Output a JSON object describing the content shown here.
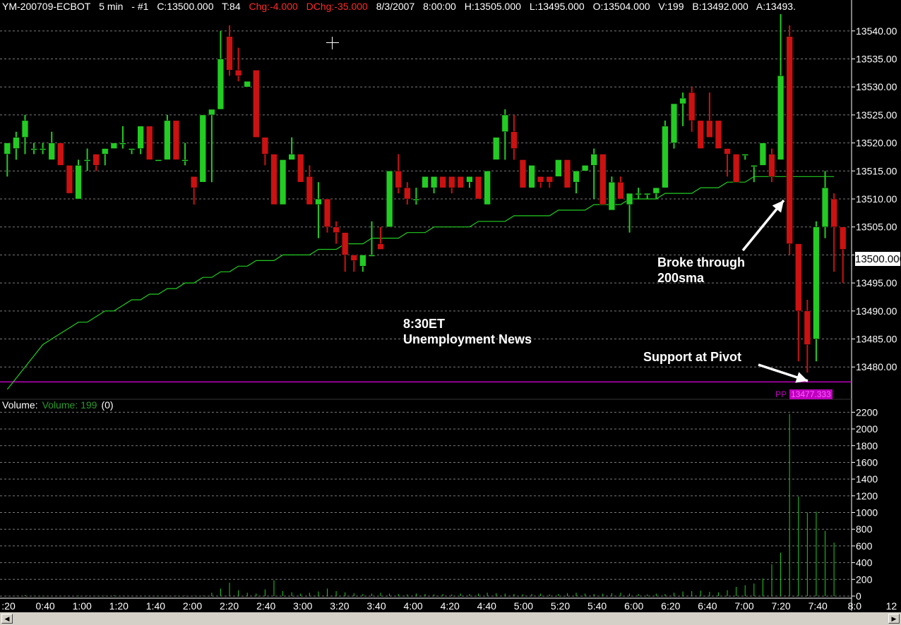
{
  "header": {
    "symbol": "YM-200709-ECBOT",
    "interval": "5 min",
    "chart_id": "- #1",
    "close": "C:13500.000",
    "ticks": "T:84",
    "change": "Chg:-4.000",
    "day_change": "DChg:-35.000",
    "date": "8/3/2007",
    "time": "8:00:00",
    "high": "H:13505.000",
    "low": "L:13495.000",
    "open": "O:13504.000",
    "volume": "V:199",
    "bid": "B:13492.000",
    "ask": "A:13493."
  },
  "volume_legend": {
    "label": "Volume:",
    "series": "Volume: 199",
    "value": "(0)"
  },
  "annotations": {
    "news_line1": "8:30ET",
    "news_line2": "Unemployment News",
    "sma_line1": "Broke through",
    "sma_line2": "200sma",
    "pivot": "Support at Pivot"
  },
  "pivot": {
    "label": "PP",
    "value": "13477.333",
    "color": "#c000c0"
  },
  "current_price_label": "13500.000",
  "colors": {
    "up": "#22cc22",
    "down": "#cc1111",
    "sma": "#22cc22",
    "grid": "#7a7a7a",
    "background": "#000000"
  },
  "chart_data": {
    "type": "candlestick",
    "price_ticks": [
      "13540.00",
      "13535.00",
      "13530.00",
      "13525.00",
      "13520.00",
      "13515.00",
      "13510.00",
      "13505.00",
      "13500.00",
      "13495.00",
      "13490.00",
      "13485.00",
      "13480.00"
    ],
    "price_range": [
      13476,
      13543
    ],
    "volume_ticks": [
      "2200",
      "2000",
      "1800",
      "1600",
      "1400",
      "1200",
      "1000",
      "800",
      "600",
      "400",
      "200",
      "0"
    ],
    "volume_range": [
      0,
      2220
    ],
    "time_ticks": [
      ":20",
      "0:40",
      "1:00",
      "1:20",
      "1:40",
      "2:00",
      "2:20",
      "2:40",
      "3:00",
      "3:20",
      "3:40",
      "4:00",
      "4:20",
      "4:40",
      "5:00",
      "5:20",
      "5:40",
      "6:00",
      "6:20",
      "6:40",
      "7:00",
      "7:20",
      "7:40",
      "8:0",
      "12"
    ],
    "candles": [
      {
        "o": 13518,
        "h": 13520,
        "l": 13514,
        "c": 13520
      },
      {
        "o": 13519,
        "h": 13522,
        "l": 13517,
        "c": 13521
      },
      {
        "o": 13521,
        "h": 13525,
        "l": 13518,
        "c": 13524
      },
      {
        "o": 13519,
        "h": 13520,
        "l": 13518,
        "c": 13519
      },
      {
        "o": 13519,
        "h": 13520,
        "l": 13518,
        "c": 13519
      },
      {
        "o": 13517,
        "h": 13522,
        "l": 13517,
        "c": 13520
      },
      {
        "o": 13520,
        "h": 13520,
        "l": 13516,
        "c": 13516
      },
      {
        "o": 13516,
        "h": 13516,
        "l": 13511,
        "c": 13511
      },
      {
        "o": 13510,
        "h": 13517,
        "l": 13510,
        "c": 13516
      },
      {
        "o": 13517,
        "h": 13519,
        "l": 13515,
        "c": 13517
      },
      {
        "o": 13518,
        "h": 13518,
        "l": 13515,
        "c": 13516
      },
      {
        "o": 13518,
        "h": 13519,
        "l": 13516,
        "c": 13519
      },
      {
        "o": 13519,
        "h": 13520,
        "l": 13519,
        "c": 13520
      },
      {
        "o": 13520,
        "h": 13523,
        "l": 13519,
        "c": 13520
      },
      {
        "o": 13519,
        "h": 13519,
        "l": 13518,
        "c": 13519
      },
      {
        "o": 13519,
        "h": 13523,
        "l": 13518,
        "c": 13523
      },
      {
        "o": 13523,
        "h": 13523,
        "l": 13517,
        "c": 13517
      },
      {
        "o": 13517,
        "h": 13517,
        "l": 13517,
        "c": 13517
      },
      {
        "o": 13517,
        "h": 13525,
        "l": 13517,
        "c": 13524
      },
      {
        "o": 13524,
        "h": 13524,
        "l": 13517,
        "c": 13517
      },
      {
        "o": 13517,
        "h": 13520,
        "l": 13516,
        "c": 13517
      },
      {
        "o": 13514,
        "h": 13514,
        "l": 13509,
        "c": 13512
      },
      {
        "o": 13513,
        "h": 13525,
        "l": 13513,
        "c": 13525
      },
      {
        "o": 13525,
        "h": 13526,
        "l": 13513,
        "c": 13526
      },
      {
        "o": 13526,
        "h": 13540,
        "l": 13526,
        "c": 13535
      },
      {
        "o": 13539,
        "h": 13541,
        "l": 13532,
        "c": 13533
      },
      {
        "o": 13533,
        "h": 13537,
        "l": 13531,
        "c": 13532
      },
      {
        "o": 13530,
        "h": 13531,
        "l": 13530,
        "c": 13531
      },
      {
        "o": 13533,
        "h": 13533,
        "l": 13521,
        "c": 13521
      },
      {
        "o": 13521,
        "h": 13521,
        "l": 13516,
        "c": 13518
      },
      {
        "o": 13518,
        "h": 13518,
        "l": 13509,
        "c": 13509
      },
      {
        "o": 13509,
        "h": 13517,
        "l": 13509,
        "c": 13517
      },
      {
        "o": 13517,
        "h": 13521,
        "l": 13517,
        "c": 13518
      },
      {
        "o": 13518,
        "h": 13518,
        "l": 13513,
        "c": 13513
      },
      {
        "o": 13514,
        "h": 13516,
        "l": 13509,
        "c": 13509
      },
      {
        "o": 13509,
        "h": 13513,
        "l": 13503,
        "c": 13510
      },
      {
        "o": 13510,
        "h": 13510,
        "l": 13504,
        "c": 13505
      },
      {
        "o": 13505,
        "h": 13506,
        "l": 13502,
        "c": 13504
      },
      {
        "o": 13504,
        "h": 13504,
        "l": 13497,
        "c": 13500
      },
      {
        "o": 13500,
        "h": 13500,
        "l": 13497,
        "c": 13499
      },
      {
        "o": 13498,
        "h": 13500,
        "l": 13497,
        "c": 13500
      },
      {
        "o": 13500,
        "h": 13506,
        "l": 13500,
        "c": 13500
      },
      {
        "o": 13502,
        "h": 13505,
        "l": 13501,
        "c": 13501
      },
      {
        "o": 13505,
        "h": 13515,
        "l": 13505,
        "c": 13515
      },
      {
        "o": 13515,
        "h": 13518,
        "l": 13511,
        "c": 13512
      },
      {
        "o": 13512,
        "h": 13513,
        "l": 13509,
        "c": 13510
      },
      {
        "o": 13510,
        "h": 13512,
        "l": 13509,
        "c": 13510
      },
      {
        "o": 13512,
        "h": 13514,
        "l": 13512,
        "c": 13514
      },
      {
        "o": 13512,
        "h": 13514,
        "l": 13511,
        "c": 13514
      },
      {
        "o": 13514,
        "h": 13514,
        "l": 13512,
        "c": 13512
      },
      {
        "o": 13514,
        "h": 13514,
        "l": 13511,
        "c": 13512
      },
      {
        "o": 13514,
        "h": 13514,
        "l": 13512,
        "c": 13512
      },
      {
        "o": 13513,
        "h": 13514,
        "l": 13512,
        "c": 13514
      },
      {
        "o": 13514,
        "h": 13514,
        "l": 13510,
        "c": 13510
      },
      {
        "o": 13509,
        "h": 13515,
        "l": 13509,
        "c": 13515
      },
      {
        "o": 13517,
        "h": 13521,
        "l": 13517,
        "c": 13521
      },
      {
        "o": 13522,
        "h": 13526,
        "l": 13517,
        "c": 13525
      },
      {
        "o": 13522,
        "h": 13525,
        "l": 13517,
        "c": 13519
      },
      {
        "o": 13517,
        "h": 13517,
        "l": 13512,
        "c": 13512
      },
      {
        "o": 13512,
        "h": 13516,
        "l": 13512,
        "c": 13516
      },
      {
        "o": 13514,
        "h": 13514,
        "l": 13512,
        "c": 13513
      },
      {
        "o": 13514,
        "h": 13514,
        "l": 13512,
        "c": 13513
      },
      {
        "o": 13514,
        "h": 13517,
        "l": 13514,
        "c": 13517
      },
      {
        "o": 13517,
        "h": 13517,
        "l": 13512,
        "c": 13512
      },
      {
        "o": 13513,
        "h": 13515,
        "l": 13511,
        "c": 13515
      },
      {
        "o": 13515,
        "h": 13516,
        "l": 13515,
        "c": 13516
      },
      {
        "o": 13516,
        "h": 13519,
        "l": 13510,
        "c": 13518
      },
      {
        "o": 13518,
        "h": 13518,
        "l": 13509,
        "c": 13509
      },
      {
        "o": 13508,
        "h": 13514,
        "l": 13508,
        "c": 13513
      },
      {
        "o": 13513,
        "h": 13514,
        "l": 13510,
        "c": 13510
      },
      {
        "o": 13509,
        "h": 13511,
        "l": 13504,
        "c": 13511
      },
      {
        "o": 13511,
        "h": 13512,
        "l": 13510,
        "c": 13511
      },
      {
        "o": 13511,
        "h": 13511,
        "l": 13510,
        "c": 13511
      },
      {
        "o": 13511,
        "h": 13512,
        "l": 13510,
        "c": 13512
      },
      {
        "o": 13512,
        "h": 13524,
        "l": 13512,
        "c": 13523
      },
      {
        "o": 13520,
        "h": 13527,
        "l": 13519,
        "c": 13527
      },
      {
        "o": 13527,
        "h": 13529,
        "l": 13523,
        "c": 13528
      },
      {
        "o": 13529,
        "h": 13530,
        "l": 13522,
        "c": 13524
      },
      {
        "o": 13524,
        "h": 13524,
        "l": 13519,
        "c": 13519
      },
      {
        "o": 13524,
        "h": 13529,
        "l": 13521,
        "c": 13521
      },
      {
        "o": 13524,
        "h": 13524,
        "l": 13519,
        "c": 13519
      },
      {
        "o": 13519,
        "h": 13519,
        "l": 13514,
        "c": 13518
      },
      {
        "o": 13518,
        "h": 13518,
        "l": 13513,
        "c": 13513
      },
      {
        "o": 13518,
        "h": 13518,
        "l": 13517,
        "c": 13518
      },
      {
        "o": 13516,
        "h": 13516,
        "l": 13513,
        "c": 13516
      },
      {
        "o": 13516,
        "h": 13520,
        "l": 13516,
        "c": 13520
      },
      {
        "o": 13518,
        "h": 13519,
        "l": 13513,
        "c": 13514
      },
      {
        "o": 13517,
        "h": 13543,
        "l": 13517,
        "c": 13532
      },
      {
        "o": 13539,
        "h": 13541,
        "l": 13500,
        "c": 13502
      },
      {
        "o": 13502,
        "h": 13502,
        "l": 13481,
        "c": 13490
      },
      {
        "o": 13490,
        "h": 13492,
        "l": 13479,
        "c": 13484
      },
      {
        "o": 13485,
        "h": 13506,
        "l": 13481,
        "c": 13505
      },
      {
        "o": 13505,
        "h": 13515,
        "l": 13503,
        "c": 13512
      },
      {
        "o": 13510,
        "h": 13511,
        "l": 13497,
        "c": 13505
      },
      {
        "o": 13505,
        "h": 13505,
        "l": 13495,
        "c": 13501
      }
    ],
    "volume": [
      3,
      4,
      12,
      4,
      5,
      4,
      3,
      4,
      6,
      4,
      3,
      5,
      10,
      4,
      3,
      4,
      5,
      4,
      3,
      4,
      6,
      4,
      5,
      40,
      90,
      160,
      70,
      40,
      30,
      80,
      190,
      60,
      45,
      30,
      40,
      55,
      90,
      60,
      45,
      35,
      25,
      30,
      40,
      30,
      25,
      20,
      30,
      25,
      20,
      25,
      20,
      30,
      25,
      30,
      40,
      35,
      30,
      25,
      20,
      25,
      30,
      20,
      25,
      35,
      40,
      30,
      25,
      30,
      35,
      40,
      30,
      25,
      20,
      30,
      25,
      40,
      55,
      60,
      65,
      50,
      45,
      70,
      110,
      130,
      150,
      210,
      380,
      520,
      2180,
      1190,
      1000,
      1010,
      780,
      640
    ],
    "sma200": [
      13476,
      13478,
      13480,
      13482,
      13484,
      13485,
      13486,
      13487,
      13488,
      13488,
      13489,
      13490,
      13490,
      13491,
      13492,
      13492,
      13493,
      13493,
      13494,
      13494,
      13495,
      13495,
      13496,
      13496,
      13497,
      13497,
      13498,
      13498,
      13499,
      13499,
      13499,
      13500,
      13500,
      13500,
      13500,
      13501,
      13501,
      13501,
      13502,
      13502,
      13502,
      13503,
      13503,
      13503,
      13503,
      13504,
      13504,
      13504,
      13505,
      13505,
      13505,
      13505,
      13505,
      13506,
      13506,
      13506,
      13506,
      13507,
      13507,
      13507,
      13507,
      13507,
      13508,
      13508,
      13508,
      13508,
      13509,
      13509,
      13509,
      13509,
      13510,
      13510,
      13510,
      13510,
      13511,
      13511,
      13511,
      13511,
      13512,
      13512,
      13512,
      13513,
      13513,
      13513,
      13514,
      13514,
      13514,
      13514,
      13514,
      13514,
      13514,
      13514,
      13514,
      13514
    ]
  }
}
